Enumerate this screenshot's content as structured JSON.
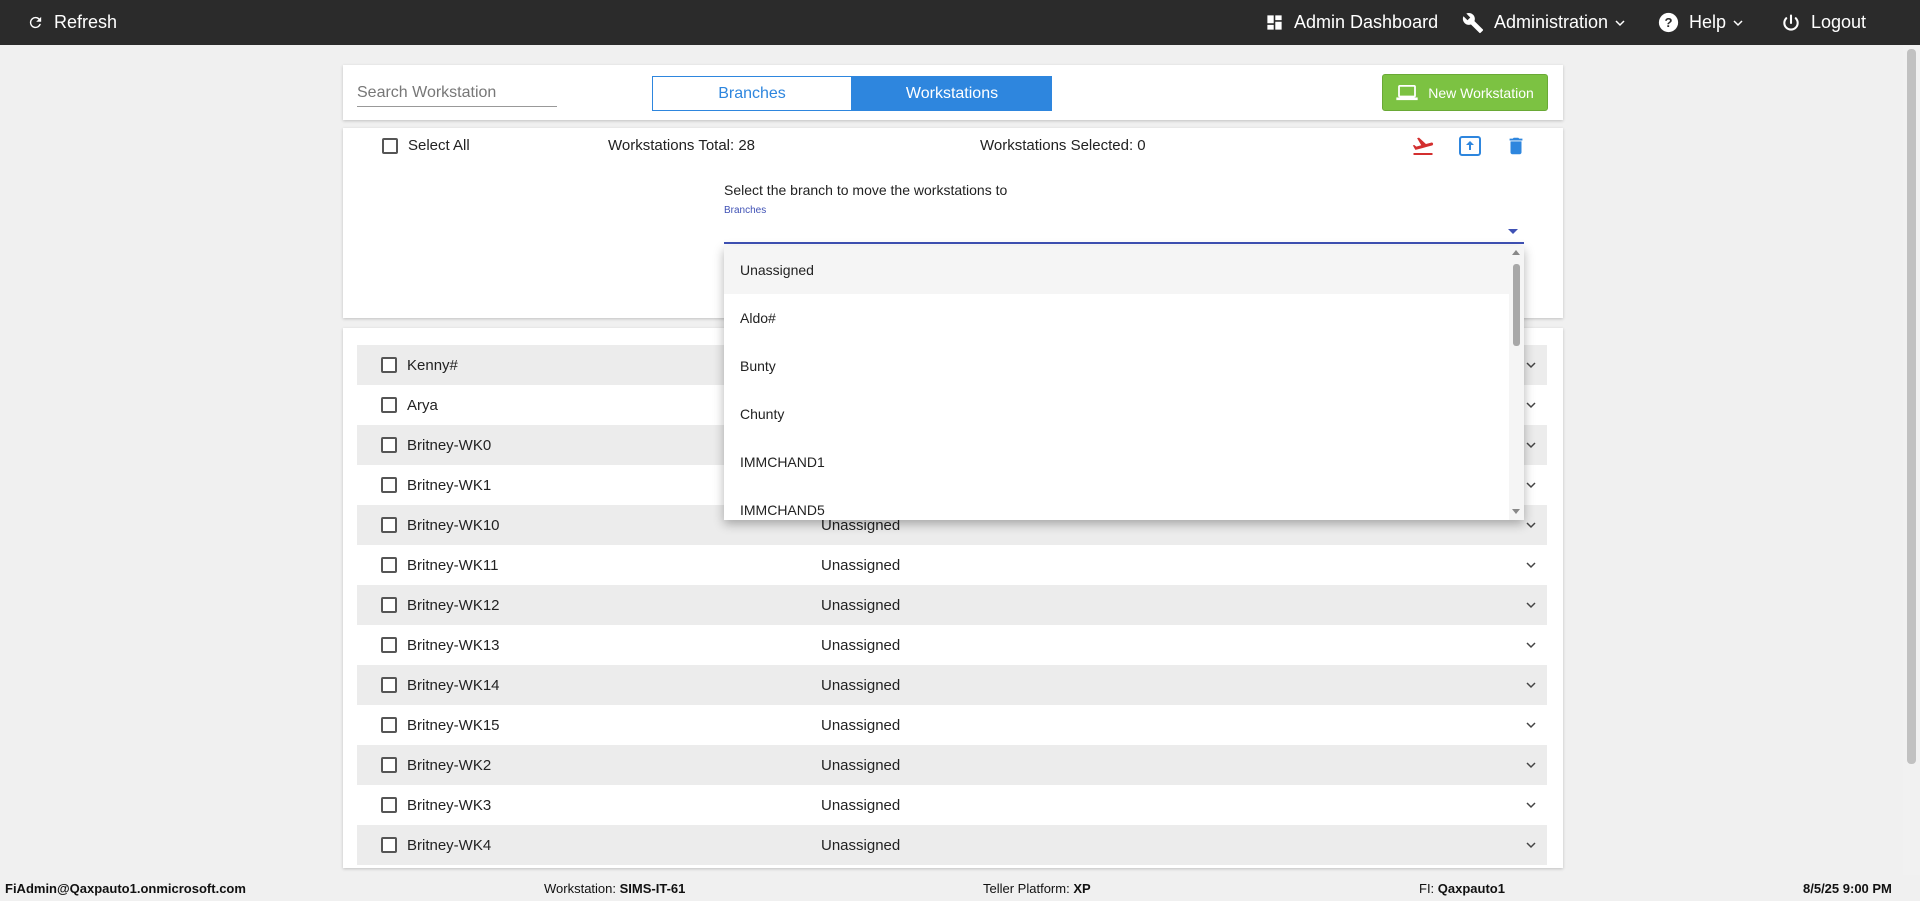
{
  "topbar": {
    "refresh_label": "Refresh",
    "admin_dashboard_label": "Admin Dashboard",
    "administration_label": "Administration",
    "help_label": "Help",
    "logout_label": "Logout"
  },
  "header": {
    "search_placeholder": "Search Workstation",
    "tab_branches": "Branches",
    "tab_workstations": "Workstations",
    "new_workstation_label": "New Workstation"
  },
  "selection": {
    "select_all_label": "Select All",
    "total_text": "Workstations Total: 28",
    "selected_text": "Workstations Selected: 0",
    "move_prompt": "Select the branch to move the workstations to",
    "branches_label": "Branches"
  },
  "dropdown": {
    "options": [
      "Unassigned",
      "Aldo#",
      "Bunty",
      "Chunty",
      "IMMCHAND1",
      "IMMCHAND5"
    ]
  },
  "workstations": [
    {
      "name": "Kenny#",
      "branch": ""
    },
    {
      "name": "Arya",
      "branch": ""
    },
    {
      "name": "Britney-WK0",
      "branch": ""
    },
    {
      "name": "Britney-WK1",
      "branch": ""
    },
    {
      "name": "Britney-WK10",
      "branch": "Unassigned"
    },
    {
      "name": "Britney-WK11",
      "branch": "Unassigned"
    },
    {
      "name": "Britney-WK12",
      "branch": "Unassigned"
    },
    {
      "name": "Britney-WK13",
      "branch": "Unassigned"
    },
    {
      "name": "Britney-WK14",
      "branch": "Unassigned"
    },
    {
      "name": "Britney-WK15",
      "branch": "Unassigned"
    },
    {
      "name": "Britney-WK2",
      "branch": "Unassigned"
    },
    {
      "name": "Britney-WK3",
      "branch": "Unassigned"
    },
    {
      "name": "Britney-WK4",
      "branch": "Unassigned"
    }
  ],
  "statusbar": {
    "user": "FiAdmin@Qaxpauto1.onmicrosoft.com",
    "workstation_label": "Workstation:",
    "workstation_value": "SIMS-IT-61",
    "platform_label": "Teller Platform:",
    "platform_value": "XP",
    "fi_label": "FI:",
    "fi_value": "Qaxpauto1",
    "datetime": "8/5/25 9:00 PM"
  },
  "colors": {
    "topbar_bg": "#2b2b2b",
    "accent_blue": "#2e86de",
    "new_button_green": "#7cc242",
    "move_icon_red": "#d32f2f",
    "select_underline": "#3f51b5"
  }
}
